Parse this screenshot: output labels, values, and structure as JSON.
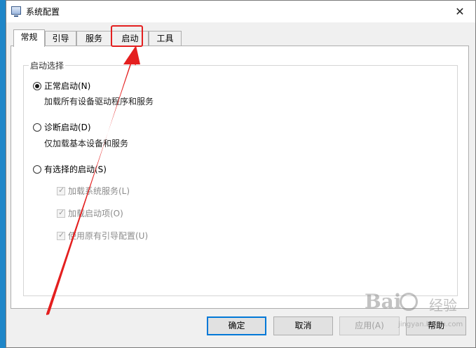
{
  "window": {
    "title": "系统配置",
    "close_glyph": "✕"
  },
  "tabs": [
    {
      "label": "常规",
      "active": true
    },
    {
      "label": "引导",
      "active": false
    },
    {
      "label": "服务",
      "active": false
    },
    {
      "label": "启动",
      "active": false
    },
    {
      "label": "工具",
      "active": false
    }
  ],
  "startup_group": {
    "label": "启动选择",
    "normal": {
      "label": "正常启动(N)",
      "checked": true,
      "desc": "加载所有设备驱动程序和服务"
    },
    "diagnostic": {
      "label": "诊断启动(D)",
      "checked": false,
      "desc": "仅加载基本设备和服务"
    },
    "selective": {
      "label": "有选择的启动(S)",
      "checked": false
    },
    "options": [
      {
        "label": "加载系统服务(L)",
        "checked": true,
        "enabled": false
      },
      {
        "label": "加载启动项(O)",
        "checked": true,
        "enabled": false
      },
      {
        "label": "使用原有引导配置(U)",
        "checked": true,
        "enabled": false
      }
    ]
  },
  "buttons": {
    "ok": "确定",
    "cancel": "取消",
    "apply": "应用(A)",
    "help": "帮助"
  },
  "annotation": {
    "color": "#e41f1f"
  },
  "watermark": {
    "logo": "Bai",
    "text": "经验",
    "url": "jingyan.baidu.com"
  }
}
